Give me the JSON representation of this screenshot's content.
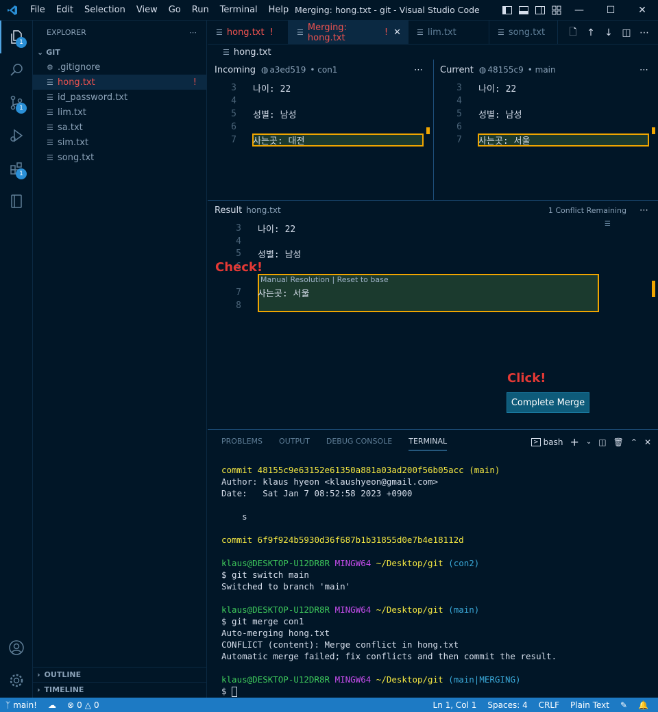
{
  "window": {
    "title": "Merging: hong.txt - git - Visual Studio Code",
    "menu": [
      "File",
      "Edit",
      "Selection",
      "View",
      "Go",
      "Run",
      "Terminal",
      "Help"
    ]
  },
  "activity": {
    "explorer_badge": "1",
    "scm_badge": "1",
    "extensions_badge": "1"
  },
  "sidebar": {
    "header": "EXPLORER",
    "folder": "GIT",
    "files": [
      {
        "name": ".gitignore",
        "mark": ""
      },
      {
        "name": "hong.txt",
        "mark": "!"
      },
      {
        "name": "id_password.txt",
        "mark": ""
      },
      {
        "name": "lim.txt",
        "mark": ""
      },
      {
        "name": "sa.txt",
        "mark": ""
      },
      {
        "name": "sim.txt",
        "mark": ""
      },
      {
        "name": "song.txt",
        "mark": ""
      }
    ],
    "outline": "OUTLINE",
    "timeline": "TIMELINE"
  },
  "tabs": [
    {
      "label": "hong.txt",
      "mark": "!"
    },
    {
      "label": "Merging: hong.txt",
      "mark": "!"
    },
    {
      "label": "lim.txt",
      "mark": ""
    },
    {
      "label": "song.txt",
      "mark": ""
    }
  ],
  "breadcrumb": "hong.txt",
  "incoming": {
    "label": "Incoming",
    "hash": "a3ed519",
    "branch": "con1",
    "lines": [
      {
        "num": "3",
        "text": "나이: 22"
      },
      {
        "num": "4",
        "text": ""
      },
      {
        "num": "5",
        "text": "성별: 남성"
      },
      {
        "num": "6",
        "text": ""
      },
      {
        "num": "7",
        "text": "사는곳: 대전"
      }
    ]
  },
  "current": {
    "label": "Current",
    "hash": "48155c9",
    "branch": "main",
    "lines": [
      {
        "num": "3",
        "text": "나이: 22"
      },
      {
        "num": "4",
        "text": ""
      },
      {
        "num": "5",
        "text": "성별: 남성"
      },
      {
        "num": "6",
        "text": ""
      },
      {
        "num": "7",
        "text": "사는곳: 서울"
      }
    ]
  },
  "result": {
    "label": "Result",
    "file": "hong.txt",
    "conflicts": "1 Conflict Remaining",
    "lines": [
      {
        "num": "3",
        "text": "나이: 22"
      },
      {
        "num": "4",
        "text": ""
      },
      {
        "num": "5",
        "text": "성별: 남성"
      },
      {
        "num": "6",
        "text": ""
      },
      {
        "num": "7",
        "text": "사는곳: 서울"
      },
      {
        "num": "8",
        "text": ""
      }
    ],
    "codelens": "Manual Resolution | Reset to base",
    "complete_button": "Complete Merge"
  },
  "annotations": {
    "check": "Check!",
    "click": "Click!"
  },
  "panel": {
    "tabs": [
      "PROBLEMS",
      "OUTPUT",
      "DEBUG CONSOLE",
      "TERMINAL"
    ],
    "shell": "bash"
  },
  "terminal": {
    "commit1_hash": "commit 48155c9e63152e61350a881a03ad200f56b05acc",
    "commit1_ref": "(main)",
    "author": "Author: klaus hyeon <klaushyeon@gmail.com>",
    "date": "Date:   Sat Jan 7 08:52:58 2023 +0900",
    "msg": "    s",
    "commit2": "commit 6f9f924b5930d36f687b1b31855d0e7b4e18112d",
    "user": "klaus@DESKTOP-U12DR8R",
    "env": "MINGW64",
    "path": "~/Desktop/git",
    "branch_con2": "(con2)",
    "cmd_switch": "$ git switch main",
    "out_switch": "Switched to branch 'main'",
    "branch_main": "(main)",
    "cmd_merge": "$ git merge con1",
    "out_merge1": "Auto-merging hong.txt",
    "out_merge2": "CONFLICT (content): Merge conflict in hong.txt",
    "out_merge3": "Automatic merge failed; fix conflicts and then commit the result.",
    "branch_merging": "(main|MERGING)",
    "prompt": "$ "
  },
  "statusbar": {
    "branch": "main!",
    "errors": "0",
    "warnings": "0",
    "position": "Ln 1, Col 1",
    "spaces": "Spaces: 4",
    "eol": "CRLF",
    "language": "Plain Text"
  },
  "colors": {
    "conflict_border": "#f0a500",
    "status_bar": "#1d7ac4",
    "accent": "#4fa3e0"
  }
}
